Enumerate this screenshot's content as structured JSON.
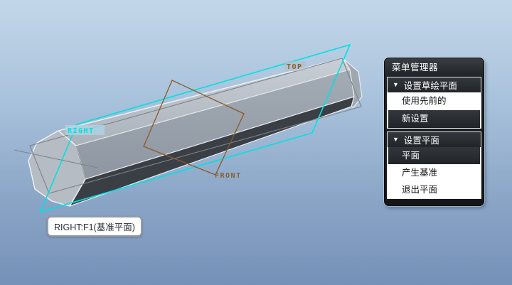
{
  "scene": {
    "datum_labels": {
      "top": "TOP",
      "right": "RIGHT",
      "front": "FRONT"
    },
    "tooltip": "RIGHT:F1(基准平面)",
    "colors": {
      "highlight_cyan": "#00e2e2",
      "datum_brown": "#8a5a28",
      "datum_gray": "#7d8288",
      "label_brown": "#8a5e2e",
      "bg_top": "#c3d7e9",
      "bg_bottom": "#7691b8"
    }
  },
  "menu_manager": {
    "title": "菜单管理器",
    "collapse_icon": "▼",
    "sections": [
      {
        "header": "设置草绘平面",
        "items": [
          {
            "label": "使用先前的",
            "selected": false
          },
          {
            "label": "新设置",
            "selected": true
          }
        ]
      },
      {
        "header": "设置平面",
        "items": [
          {
            "label": "平面",
            "selected": true
          },
          {
            "label": "产生基准",
            "selected": false
          },
          {
            "label": "退出平面",
            "selected": false
          }
        ]
      }
    ]
  }
}
